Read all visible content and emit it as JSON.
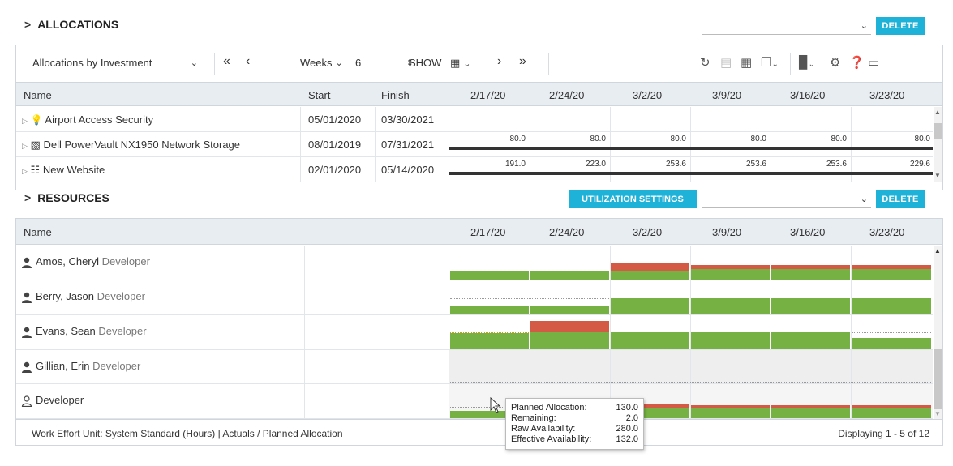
{
  "allocations": {
    "title": "ALLOCATIONS",
    "delete_label": "DELETE",
    "toolbar": {
      "view_select": "Allocations by Investment",
      "period_label": "Weeks",
      "period_count": "6",
      "show_label": "SHOW"
    },
    "columns": {
      "name": "Name",
      "start": "Start",
      "finish": "Finish"
    },
    "weeks": [
      "2/17/20",
      "2/24/20",
      "3/2/20",
      "3/9/20",
      "3/16/20",
      "3/23/20"
    ],
    "rows": [
      {
        "name": "Airport Access Security",
        "icon": "lightbulb-icon",
        "start": "05/01/2020",
        "finish": "03/30/2021",
        "values": [
          "",
          "",
          "",
          "",
          "",
          ""
        ]
      },
      {
        "name": "Dell PowerVault NX1950 Network Storage",
        "icon": "storage-icon",
        "start": "08/01/2019",
        "finish": "07/31/2021",
        "values": [
          "80.0",
          "80.0",
          "80.0",
          "80.0",
          "80.0",
          "80.0"
        ]
      },
      {
        "name": "New Website",
        "icon": "hierarchy-icon",
        "start": "02/01/2020",
        "finish": "05/14/2020",
        "values": [
          "191.0",
          "223.0",
          "253.6",
          "253.6",
          "253.6",
          "229.6"
        ]
      }
    ]
  },
  "resources": {
    "title": "RESOURCES",
    "utilization_label": "UTILIZATION SETTINGS",
    "delete_label": "DELETE",
    "columns": {
      "name": "Name"
    },
    "weeks": [
      "2/17/20",
      "2/24/20",
      "3/2/20",
      "3/9/20",
      "3/16/20",
      "3/23/20"
    ],
    "rows": [
      {
        "name": "Amos, Cheryl",
        "role": "Developer"
      },
      {
        "name": "Berry, Jason",
        "role": "Developer"
      },
      {
        "name": "Evans, Sean",
        "role": "Developer"
      },
      {
        "name": "Gillian, Erin",
        "role": "Developer"
      },
      {
        "name": "",
        "role": "Developer"
      }
    ],
    "footer_left": "Work Effort Unit: System Standard (Hours) | Actuals / Planned Allocation",
    "footer_right": "Displaying 1 - 5 of 12"
  },
  "tooltip": {
    "planned_label": "Planned Allocation:",
    "planned_value": "130.0",
    "remaining_label": "Remaining:",
    "remaining_value": "2.0",
    "raw_label": "Raw Availability:",
    "raw_value": "280.0",
    "effective_label": "Effective Availability:",
    "effective_value": "132.0"
  },
  "colors": {
    "accent": "#1fb2d8",
    "over": "#d45a46",
    "allocated": "#76b243",
    "header_bg": "#e8edf2"
  }
}
